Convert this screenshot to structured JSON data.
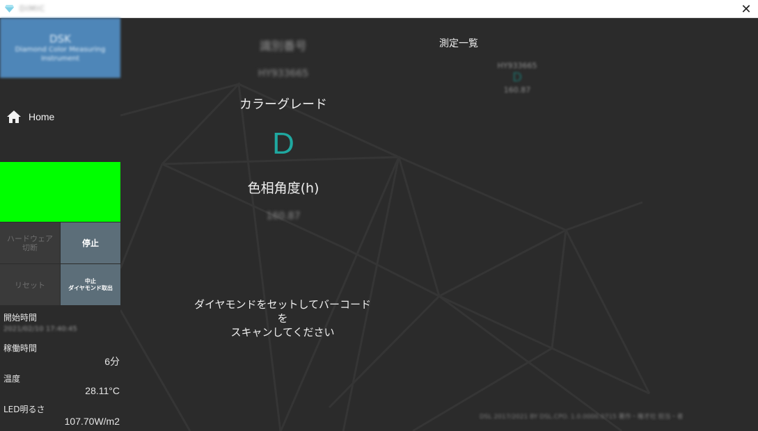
{
  "window": {
    "title": "DIMIC",
    "close_glyph": "✕"
  },
  "sidebar": {
    "brand": {
      "main": "DSK",
      "sub": "Diamond Color Measuring Instrument"
    },
    "nav": {
      "home_label": "Home"
    },
    "status_color": "#00ff00",
    "buttons": {
      "hardware_line1": "ハードウェア",
      "hardware_line2": "切断",
      "stop": "停止",
      "reset": "リセット",
      "abort_line1": "中止",
      "abort_line2": "ダイヤモンド取出"
    },
    "info": {
      "start_time_label": "開始時間",
      "start_time_value": "2021/02/10 17:40:45",
      "uptime_label": "稼働時間",
      "uptime_value": "6分",
      "temperature_label": "温度",
      "temperature_value": "28.11°C",
      "led_label": "LED明るさ",
      "led_value": "107.70W/m2"
    }
  },
  "main": {
    "serial_label": "識別番号",
    "serial_value": "HY933665",
    "grade_label": "カラーグレード",
    "grade_value": "D",
    "hue_label": "色相角度(h)",
    "hue_value": "160.87",
    "instruction_line1": "ダイヤモンドをセットしてバーコードを",
    "instruction_line2": "スキャンしてください",
    "list_title": "測定一覧",
    "list_items": [
      {
        "serial": "HY933665",
        "grade": "D",
        "hue": "160.87"
      }
    ],
    "footer_note": "DSL 2017/2021 BY DSL.CPO. 1.0.0000.0715 著作・権才社 担当・者"
  },
  "colors": {
    "accent_teal": "#1fa8a0",
    "brand_blue": "#4e86b8",
    "button_active": "#5c6e79",
    "button_disabled": "#3a3a3a"
  }
}
